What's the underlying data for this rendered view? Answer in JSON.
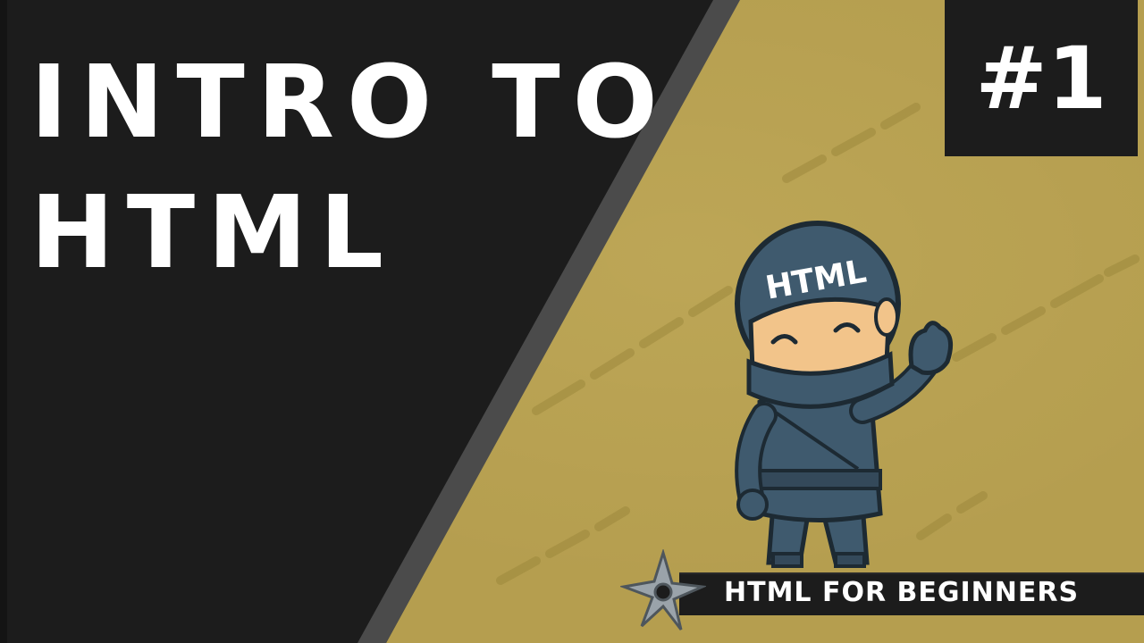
{
  "title": {
    "line1": "INTRO TO",
    "line2": "HTML"
  },
  "episode_badge": "#1",
  "mascot": {
    "helmet_text": "HTML"
  },
  "banner": {
    "label": "HTML FOR BEGINNERS"
  },
  "colors": {
    "dark_panel": "#1c1c1c",
    "gold_panel": "#b59e4f",
    "stripe": "#4b4b4b",
    "ninja_blue": "#3f5a6e",
    "text": "#ffffff"
  },
  "icons": [
    "shuriken-icon",
    "ninja-mascot"
  ]
}
